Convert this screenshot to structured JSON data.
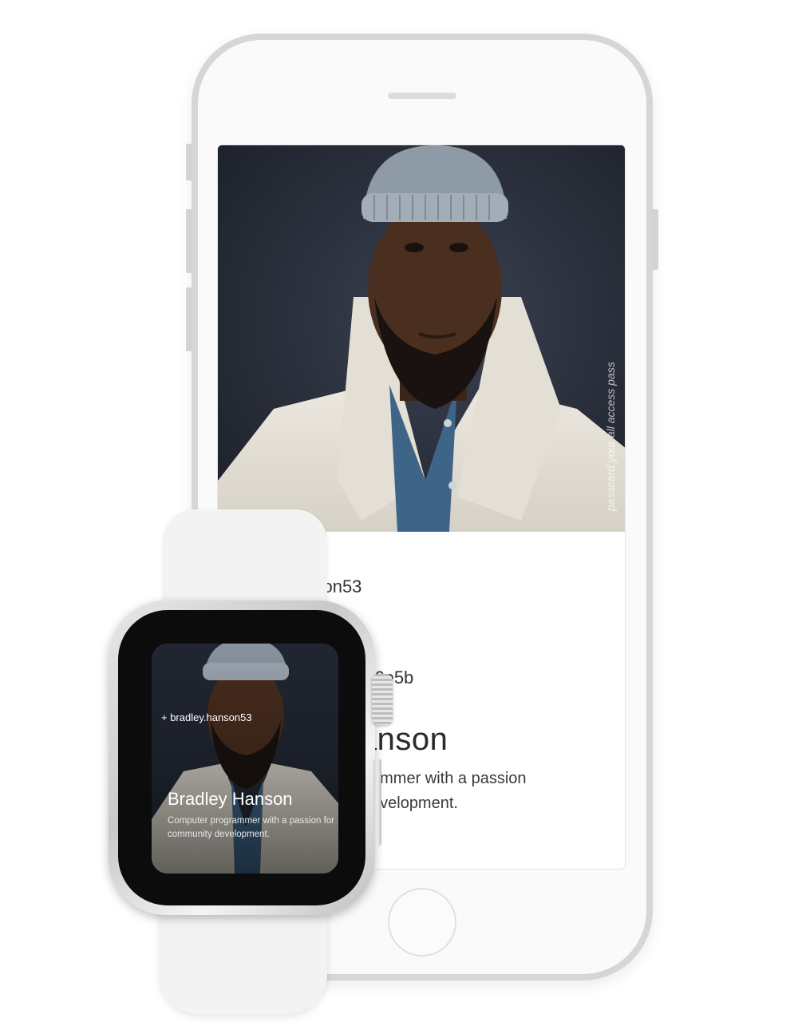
{
  "phone": {
    "card": {
      "vertical_tag": "passcard your all access pass",
      "handle_partial": "anson53",
      "code_partial": "3.6e5b",
      "name_partial": "Hanson",
      "bio_partial": "ammer with a passion\nevelopment."
    }
  },
  "watch": {
    "handle": "+ bradley.hanson53",
    "name": "Bradley Hanson",
    "bio": "Computer programmer with a passion for community development."
  },
  "colors": {
    "device_frame": "#d6d6d6",
    "watch_band": "#f3f3f3",
    "photo_background": "#262b37"
  }
}
